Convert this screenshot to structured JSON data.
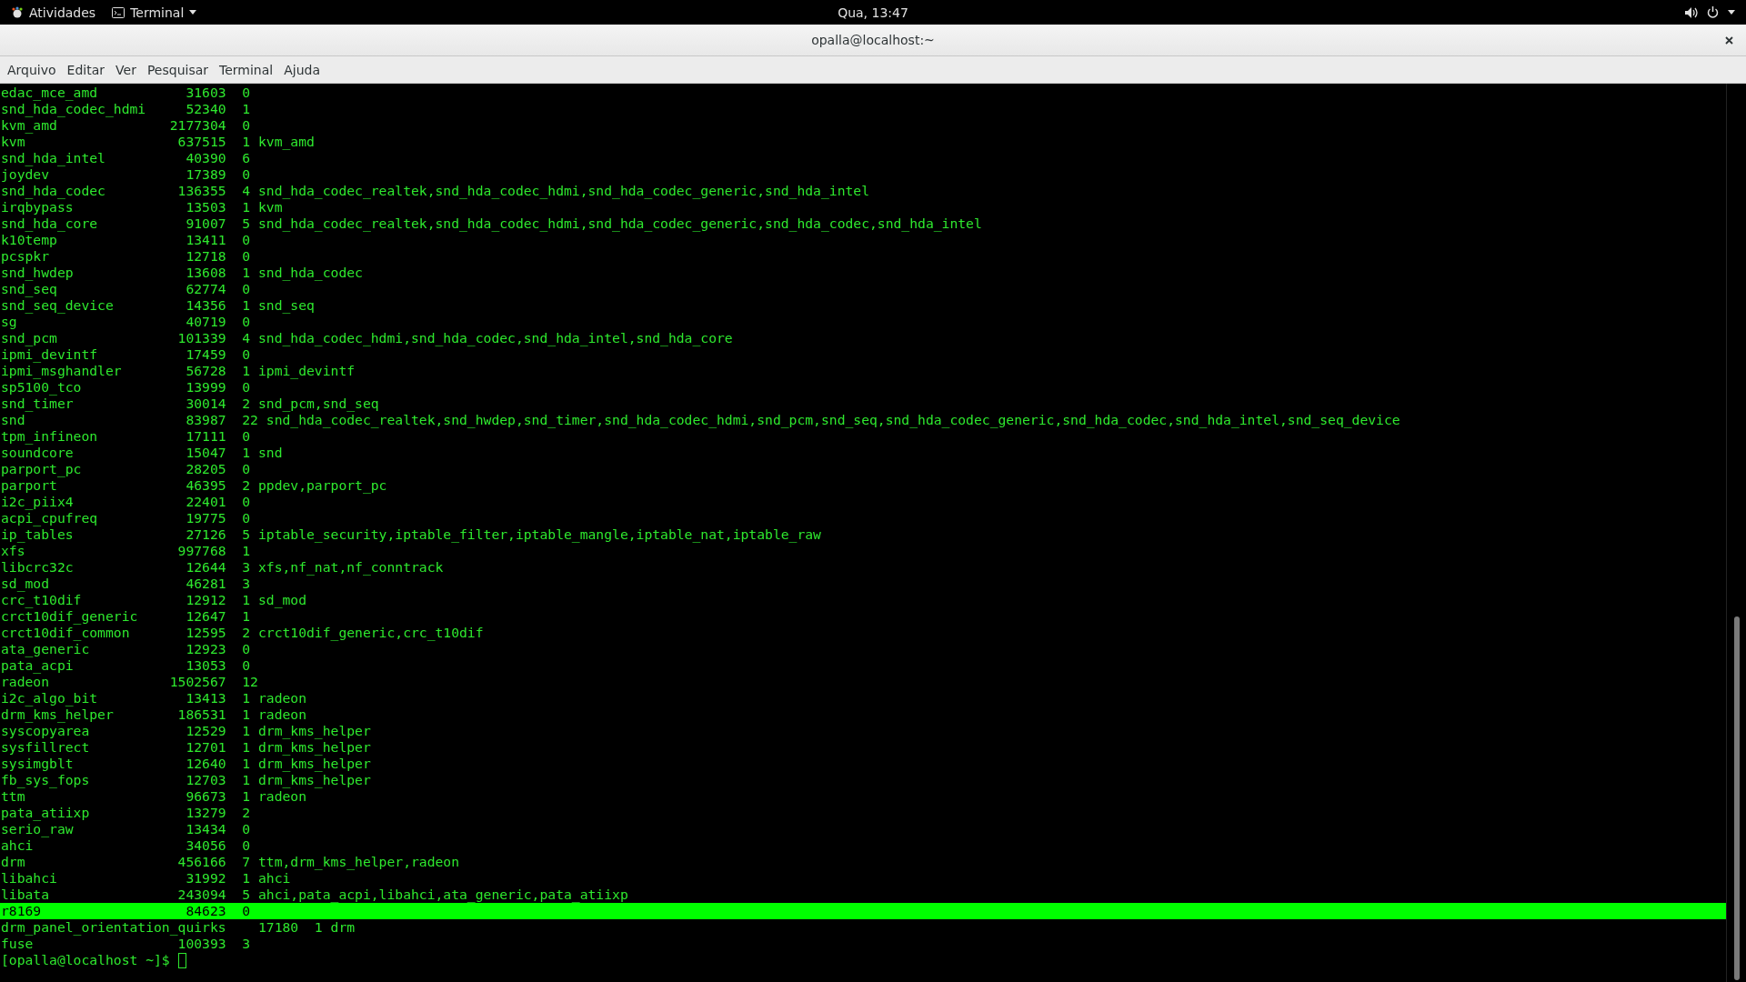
{
  "top_bar": {
    "activities": "Atividades",
    "app_menu": "Terminal",
    "clock": "Qua, 13:47"
  },
  "window": {
    "title": "opalla@localhost:~"
  },
  "menu": [
    "Arquivo",
    "Editar",
    "Ver",
    "Pesquisar",
    "Terminal",
    "Ajuda"
  ],
  "rows": [
    {
      "module": "edac_mce_amd",
      "size": "31603",
      "count": "0",
      "used_by": "",
      "selected": false
    },
    {
      "module": "snd_hda_codec_hdmi",
      "size": "52340",
      "count": "1",
      "used_by": "",
      "selected": false
    },
    {
      "module": "kvm_amd",
      "size": "2177304",
      "count": "0",
      "used_by": "",
      "selected": false
    },
    {
      "module": "kvm",
      "size": "637515",
      "count": "1",
      "used_by": "kvm_amd",
      "selected": false
    },
    {
      "module": "snd_hda_intel",
      "size": "40390",
      "count": "6",
      "used_by": "",
      "selected": false
    },
    {
      "module": "joydev",
      "size": "17389",
      "count": "0",
      "used_by": "",
      "selected": false
    },
    {
      "module": "snd_hda_codec",
      "size": "136355",
      "count": "4",
      "used_by": "snd_hda_codec_realtek,snd_hda_codec_hdmi,snd_hda_codec_generic,snd_hda_intel",
      "selected": false
    },
    {
      "module": "irqbypass",
      "size": "13503",
      "count": "1",
      "used_by": "kvm",
      "selected": false
    },
    {
      "module": "snd_hda_core",
      "size": "91007",
      "count": "5",
      "used_by": "snd_hda_codec_realtek,snd_hda_codec_hdmi,snd_hda_codec_generic,snd_hda_codec,snd_hda_intel",
      "selected": false
    },
    {
      "module": "k10temp",
      "size": "13411",
      "count": "0",
      "used_by": "",
      "selected": false
    },
    {
      "module": "pcspkr",
      "size": "12718",
      "count": "0",
      "used_by": "",
      "selected": false
    },
    {
      "module": "snd_hwdep",
      "size": "13608",
      "count": "1",
      "used_by": "snd_hda_codec",
      "selected": false
    },
    {
      "module": "snd_seq",
      "size": "62774",
      "count": "0",
      "used_by": "",
      "selected": false
    },
    {
      "module": "snd_seq_device",
      "size": "14356",
      "count": "1",
      "used_by": "snd_seq",
      "selected": false
    },
    {
      "module": "sg",
      "size": "40719",
      "count": "0",
      "used_by": "",
      "selected": false
    },
    {
      "module": "snd_pcm",
      "size": "101339",
      "count": "4",
      "used_by": "snd_hda_codec_hdmi,snd_hda_codec,snd_hda_intel,snd_hda_core",
      "selected": false
    },
    {
      "module": "ipmi_devintf",
      "size": "17459",
      "count": "0",
      "used_by": "",
      "selected": false
    },
    {
      "module": "ipmi_msghandler",
      "size": "56728",
      "count": "1",
      "used_by": "ipmi_devintf",
      "selected": false
    },
    {
      "module": "sp5100_tco",
      "size": "13999",
      "count": "0",
      "used_by": "",
      "selected": false
    },
    {
      "module": "snd_timer",
      "size": "30014",
      "count": "2",
      "used_by": "snd_pcm,snd_seq",
      "selected": false
    },
    {
      "module": "snd",
      "size": "83987",
      "count": "22",
      "used_by": "snd_hda_codec_realtek,snd_hwdep,snd_timer,snd_hda_codec_hdmi,snd_pcm,snd_seq,snd_hda_codec_generic,snd_hda_codec,snd_hda_intel,snd_seq_device",
      "selected": false
    },
    {
      "module": "tpm_infineon",
      "size": "17111",
      "count": "0",
      "used_by": "",
      "selected": false
    },
    {
      "module": "soundcore",
      "size": "15047",
      "count": "1",
      "used_by": "snd",
      "selected": false
    },
    {
      "module": "parport_pc",
      "size": "28205",
      "count": "0",
      "used_by": "",
      "selected": false
    },
    {
      "module": "parport",
      "size": "46395",
      "count": "2",
      "used_by": "ppdev,parport_pc",
      "selected": false
    },
    {
      "module": "i2c_piix4",
      "size": "22401",
      "count": "0",
      "used_by": "",
      "selected": false
    },
    {
      "module": "acpi_cpufreq",
      "size": "19775",
      "count": "0",
      "used_by": "",
      "selected": false
    },
    {
      "module": "ip_tables",
      "size": "27126",
      "count": "5",
      "used_by": "iptable_security,iptable_filter,iptable_mangle,iptable_nat,iptable_raw",
      "selected": false
    },
    {
      "module": "xfs",
      "size": "997768",
      "count": "1",
      "used_by": "",
      "selected": false
    },
    {
      "module": "libcrc32c",
      "size": "12644",
      "count": "3",
      "used_by": "xfs,nf_nat,nf_conntrack",
      "selected": false
    },
    {
      "module": "sd_mod",
      "size": "46281",
      "count": "3",
      "used_by": "",
      "selected": false
    },
    {
      "module": "crc_t10dif",
      "size": "12912",
      "count": "1",
      "used_by": "sd_mod",
      "selected": false
    },
    {
      "module": "crct10dif_generic",
      "size": "12647",
      "count": "1",
      "used_by": "",
      "selected": false
    },
    {
      "module": "crct10dif_common",
      "size": "12595",
      "count": "2",
      "used_by": "crct10dif_generic,crc_t10dif",
      "selected": false
    },
    {
      "module": "ata_generic",
      "size": "12923",
      "count": "0",
      "used_by": "",
      "selected": false
    },
    {
      "module": "pata_acpi",
      "size": "13053",
      "count": "0",
      "used_by": "",
      "selected": false
    },
    {
      "module": "radeon",
      "size": "1502567",
      "count": "12",
      "used_by": "",
      "selected": false
    },
    {
      "module": "i2c_algo_bit",
      "size": "13413",
      "count": "1",
      "used_by": "radeon",
      "selected": false
    },
    {
      "module": "drm_kms_helper",
      "size": "186531",
      "count": "1",
      "used_by": "radeon",
      "selected": false
    },
    {
      "module": "syscopyarea",
      "size": "12529",
      "count": "1",
      "used_by": "drm_kms_helper",
      "selected": false
    },
    {
      "module": "sysfillrect",
      "size": "12701",
      "count": "1",
      "used_by": "drm_kms_helper",
      "selected": false
    },
    {
      "module": "sysimgblt",
      "size": "12640",
      "count": "1",
      "used_by": "drm_kms_helper",
      "selected": false
    },
    {
      "module": "fb_sys_fops",
      "size": "12703",
      "count": "1",
      "used_by": "drm_kms_helper",
      "selected": false
    },
    {
      "module": "ttm",
      "size": "96673",
      "count": "1",
      "used_by": "radeon",
      "selected": false
    },
    {
      "module": "pata_atiixp",
      "size": "13279",
      "count": "2",
      "used_by": "",
      "selected": false
    },
    {
      "module": "serio_raw",
      "size": "13434",
      "count": "0",
      "used_by": "",
      "selected": false
    },
    {
      "module": "ahci",
      "size": "34056",
      "count": "0",
      "used_by": "",
      "selected": false
    },
    {
      "module": "drm",
      "size": "456166",
      "count": "7",
      "used_by": "ttm,drm_kms_helper,radeon",
      "selected": false
    },
    {
      "module": "libahci",
      "size": "31992",
      "count": "1",
      "used_by": "ahci",
      "selected": false
    },
    {
      "module": "libata",
      "size": "243094",
      "count": "5",
      "used_by": "ahci,pata_acpi,libahci,ata_generic,pata_atiixp",
      "selected": false
    },
    {
      "module": "r8169",
      "size": "84623",
      "count": "0",
      "used_by": "",
      "selected": true
    },
    {
      "module": "drm_panel_orientation_quirks",
      "size": "17180",
      "count": "1",
      "used_by": "drm",
      "selected": false
    },
    {
      "module": "fuse",
      "size": "100393",
      "count": "3",
      "used_by": "",
      "selected": false
    }
  ],
  "prompt": "[opalla@localhost ~]$"
}
